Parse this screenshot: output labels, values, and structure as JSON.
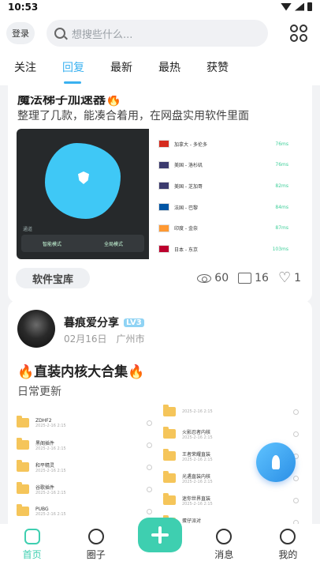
{
  "status": {
    "time": "10:53"
  },
  "header": {
    "login": "登录",
    "search_placeholder": "想搜些什么..."
  },
  "tabs": [
    "关注",
    "回复",
    "最新",
    "最热",
    "获赞"
  ],
  "post1": {
    "title": "魔法梯子加速器🔥",
    "desc": "整理了几款，能凑合着用，在网盘实用软件里面",
    "tag": "软件宝库",
    "views": "60",
    "comments": "16",
    "likes": "1",
    "image": {
      "label": "通道",
      "mode_left": "智能模式",
      "mode_right": "全局模式",
      "servers": [
        {
          "name": "加拿大 - 多伦多",
          "ms": "76ms",
          "flag_color": "#d52b1e"
        },
        {
          "name": "美国 - 洛杉矶",
          "ms": "76ms",
          "flag_color": "#3c3b6e"
        },
        {
          "name": "美国 - 芝加哥",
          "ms": "82ms",
          "flag_color": "#3c3b6e"
        },
        {
          "name": "法国 - 巴黎",
          "ms": "84ms",
          "flag_color": "#0055a4"
        },
        {
          "name": "印度 - 金奈",
          "ms": "87ms",
          "flag_color": "#ff9933"
        },
        {
          "name": "日本 - 东京",
          "ms": "103ms",
          "flag_color": "#bc002d"
        }
      ]
    }
  },
  "post2": {
    "author": "暮痕爱分享",
    "level": "LV3",
    "date": "02月16日",
    "location": "广州市",
    "title": "🔥直装内核大合集🔥",
    "desc": "日常更新",
    "files_left": [
      {
        "name": "ZDHF2",
        "meta": "2025-2-16 2:15"
      },
      {
        "name": "黑阁插件",
        "meta": "2025-2-16 2:15"
      },
      {
        "name": "和平精灵",
        "meta": "2025-2-16 2:15"
      },
      {
        "name": "谷歌插件",
        "meta": "2025-2-16 2:15"
      },
      {
        "name": "PUBG",
        "meta": "2025-2-16 2:15"
      }
    ],
    "files_right": [
      {
        "name": "",
        "meta": "2025-2-16 2:15"
      },
      {
        "name": "火影忍者内核",
        "meta": "2025-2-16 2:15"
      },
      {
        "name": "王者荣耀直装",
        "meta": "2025-2-16 2:15"
      },
      {
        "name": "光遇直装内核",
        "meta": "2025-2-16 2:15"
      },
      {
        "name": "迷你世界直装",
        "meta": "2025-2-16 2:15"
      },
      {
        "name": "蛋仔派对",
        "meta": "2025-2-16 2:15"
      }
    ]
  },
  "bottom_nav": [
    "首页",
    "圈子",
    "消息",
    "我的"
  ]
}
